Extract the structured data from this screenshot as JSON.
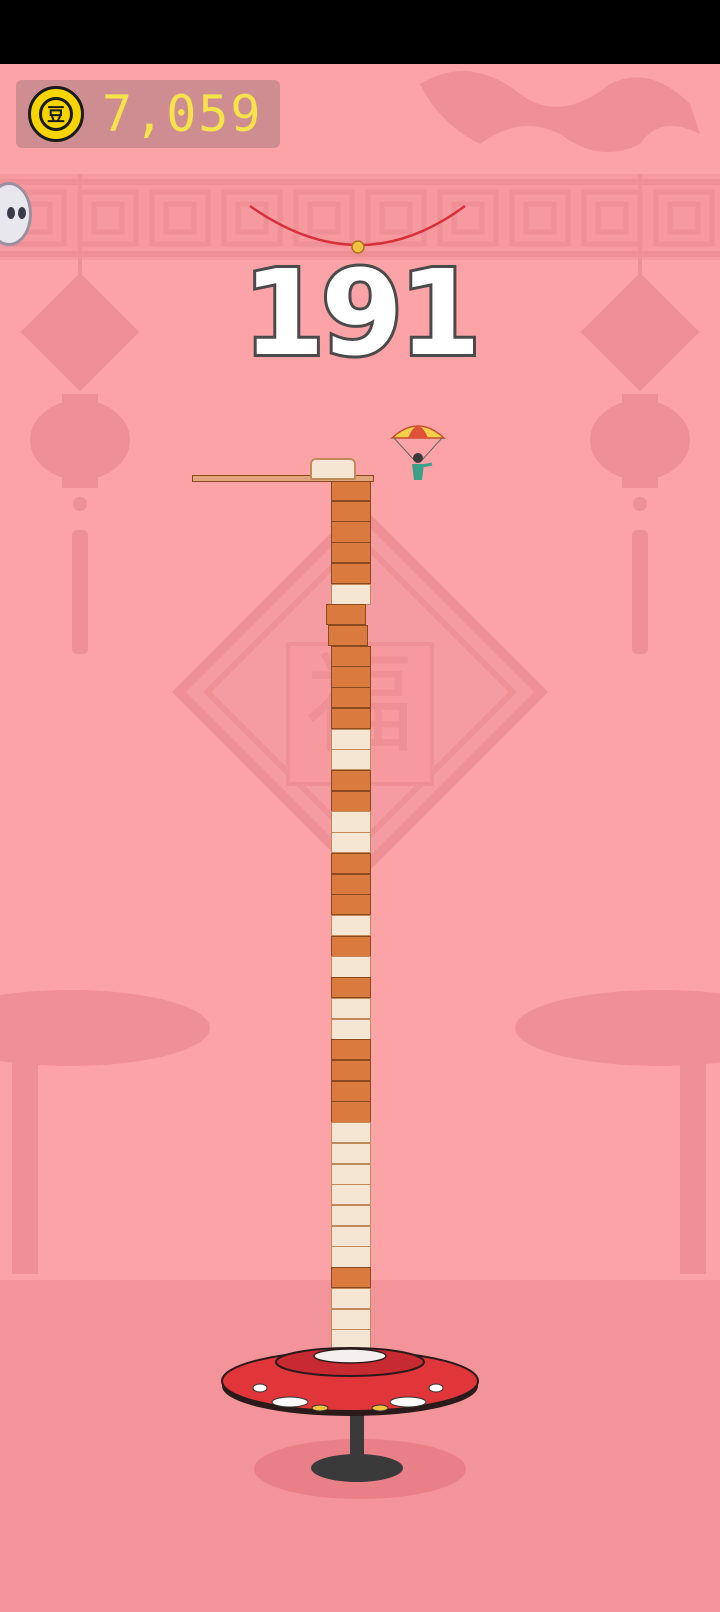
{
  "hud": {
    "coin_symbol": "豆",
    "coin_count": "7,059",
    "score": "191"
  },
  "background": {
    "fu_character": "福"
  },
  "tower": {
    "pattern": [
      "c",
      "c",
      "c",
      "c",
      "c",
      "w",
      "c",
      "c",
      "c",
      "c",
      "c",
      "c",
      "w",
      "w",
      "c",
      "c",
      "w",
      "w",
      "c",
      "c",
      "c",
      "w",
      "c",
      "w",
      "c",
      "w",
      "w",
      "c",
      "c",
      "c",
      "c",
      "w",
      "w",
      "w",
      "w",
      "w",
      "w",
      "w",
      "c",
      "w",
      "w",
      "w"
    ]
  },
  "colors": {
    "background": "#fca3a8",
    "crust": "#d97b3f",
    "bread": "#f5e6d3",
    "table": "#e0363a",
    "coin": "#f6d400",
    "score_text": "#ffffff"
  }
}
